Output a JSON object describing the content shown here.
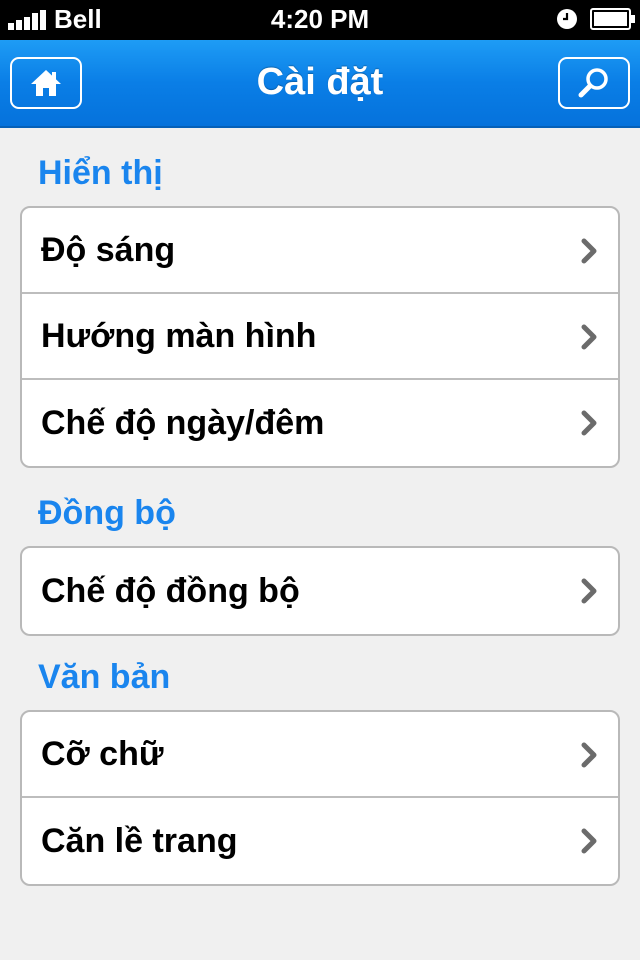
{
  "status_bar": {
    "carrier": "Bell",
    "time": "4:20 PM",
    "icons": [
      "signal-icon",
      "clock-icon",
      "battery-icon"
    ]
  },
  "nav": {
    "title": "Cài đặt",
    "left_button_icon": "home-icon",
    "right_button_icon": "search-icon"
  },
  "sections": [
    {
      "header": "Hiển thị",
      "items": [
        {
          "label": "Độ sáng"
        },
        {
          "label": "Hướng màn hình"
        },
        {
          "label": "Chế độ ngày/đêm"
        }
      ]
    },
    {
      "header": "Đồng bộ",
      "items": [
        {
          "label": "Chế độ đồng bộ"
        }
      ]
    },
    {
      "header": "Văn bản",
      "items": [
        {
          "label": "Cỡ chữ"
        },
        {
          "label": "Căn lề trang"
        }
      ]
    }
  ],
  "colors": {
    "accent": "#1a85ee",
    "nav_bar": "#0a7ee6",
    "background": "#f0f0f0"
  }
}
